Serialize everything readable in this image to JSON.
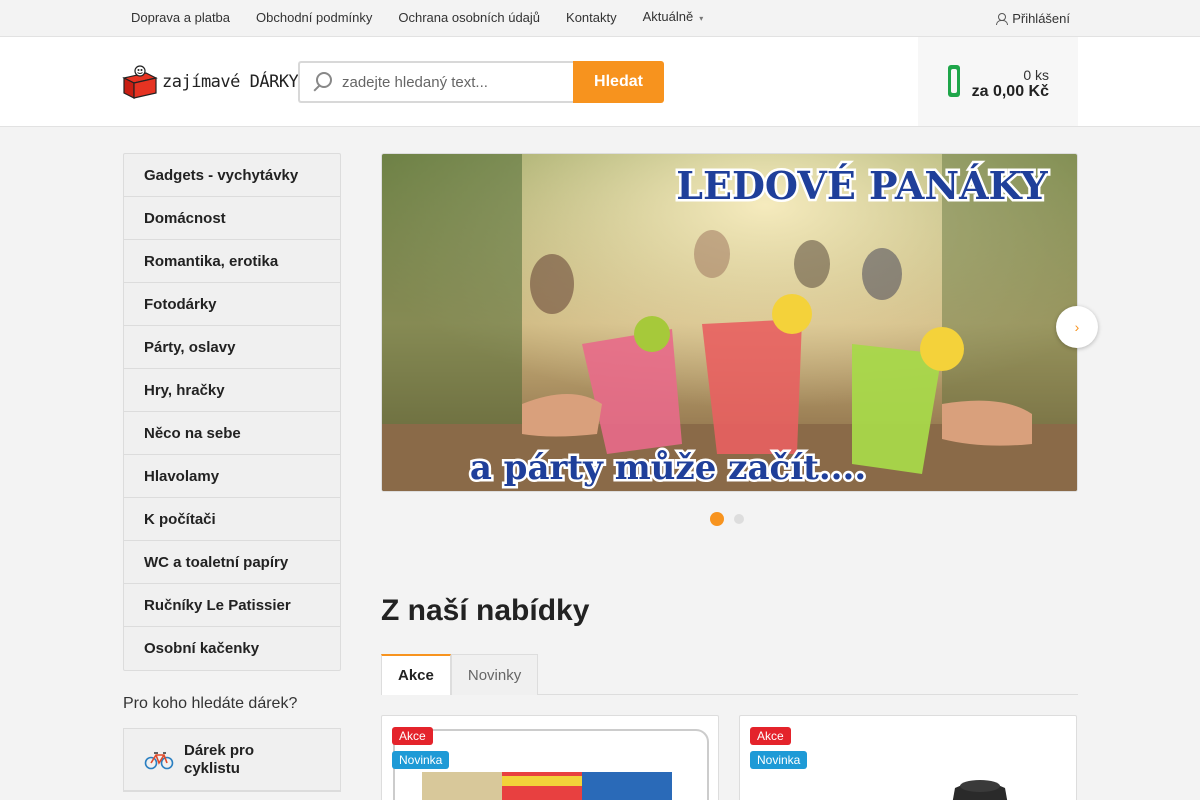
{
  "topnav": {
    "items": [
      "Doprava a platba",
      "Obchodní podmínky",
      "Ochrana osobních údajů",
      "Kontakty",
      "Aktuálně"
    ],
    "login": "Přihlášení"
  },
  "header": {
    "logo_text": "zajímavé DÁRKY",
    "search_placeholder": "zadejte hledaný text...",
    "search_button": "Hledat",
    "cart_count": "0 ks",
    "cart_total": "za 0,00 Kč"
  },
  "sidebar": {
    "items": [
      "Gadgets - vychytávky",
      "Domácnost",
      "Romantika, erotika",
      "Fotodárky",
      "Párty, oslavy",
      "Hry, hračky",
      "Něco na sebe",
      "Hlavolamy",
      "K počítači",
      "WC a toaletní papíry",
      "Ručníky Le Patissier",
      "Osobní kačenky"
    ],
    "who_title": "Pro koho hledáte dárek?",
    "who_items": [
      "Dárek pro cyklistu"
    ]
  },
  "banner": {
    "headline": "LEDOVÉ PANÁKY",
    "tagline": "a párty může začít...."
  },
  "offer": {
    "title": "Z naší nabídky",
    "tabs": [
      "Akce",
      "Novinky"
    ],
    "badges": {
      "sale": "Akce",
      "new": "Novinka"
    }
  }
}
